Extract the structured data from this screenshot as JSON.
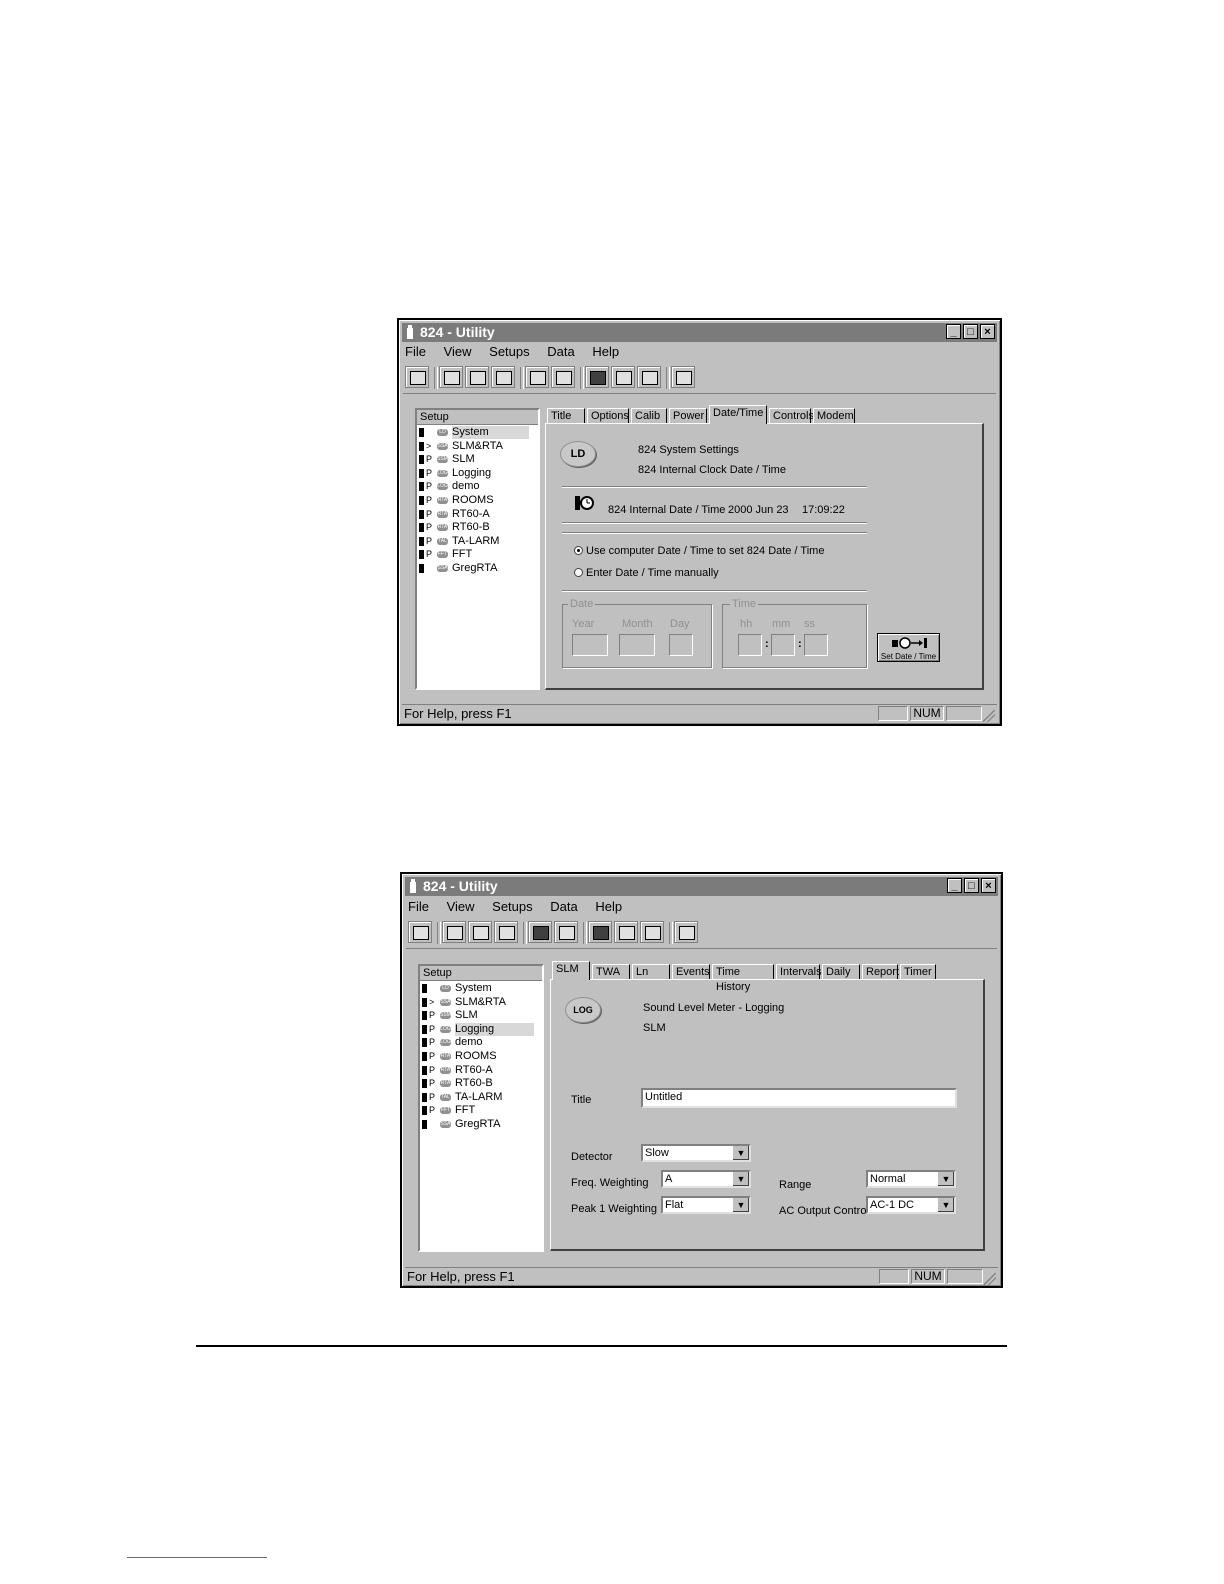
{
  "window1": {
    "title": "824 - Utility",
    "menu": [
      "File",
      "View",
      "Setups",
      "Data",
      "Help"
    ],
    "tree_header": "Setup",
    "tree_items": [
      {
        "badge": "LD",
        "label": "System",
        "mark": ""
      },
      {
        "badge": "SSA",
        "label": "SLM&RTA",
        "mark": ">"
      },
      {
        "badge": "SSM",
        "label": "SLM",
        "mark": "P"
      },
      {
        "badge": "LOG",
        "label": "Logging",
        "mark": "P"
      },
      {
        "badge": "LOG",
        "label": "demo",
        "mark": "P"
      },
      {
        "badge": "RTA",
        "label": "ROOMS",
        "mark": "P"
      },
      {
        "badge": "RTA",
        "label": "RT60-A",
        "mark": "P"
      },
      {
        "badge": "RTA",
        "label": "RT60-B",
        "mark": "P"
      },
      {
        "badge": "TAL",
        "label": "TA-LARM",
        "mark": "P"
      },
      {
        "badge": "FFT",
        "label": "FFT",
        "mark": "P"
      },
      {
        "badge": "SSA",
        "label": "GregRTA",
        "mark": ""
      }
    ],
    "tabs": [
      "Title",
      "Options",
      "Calib",
      "Power",
      "Date/Time",
      "Controls",
      "Modem"
    ],
    "logo": "LD",
    "header_line1": "824 System Settings",
    "header_line2": "824 Internal Clock Date / Time",
    "internal_label": "824 Internal Date / Time",
    "internal_date": "2000 Jun 23",
    "internal_time": "17:09:22",
    "radio_computer": "Use computer Date / Time to set 824 Date / Time",
    "radio_manual": "Enter Date / Time manually",
    "date_group": "Date",
    "year_label": "Year",
    "month_label": "Month",
    "day_label": "Day",
    "time_group": "Time",
    "hh_label": "hh",
    "mm_label": "mm",
    "ss_label": "ss",
    "set_button": "Set Date / Time",
    "status": "For Help, press F1",
    "num": "NUM"
  },
  "window2": {
    "title": "824 - Utility",
    "menu": [
      "File",
      "View",
      "Setups",
      "Data",
      "Help"
    ],
    "tree_header": "Setup",
    "tree_items": [
      {
        "badge": "LD",
        "label": "System",
        "mark": ""
      },
      {
        "badge": "SSA",
        "label": "SLM&RTA",
        "mark": ">"
      },
      {
        "badge": "SSM",
        "label": "SLM",
        "mark": "P"
      },
      {
        "badge": "LOG",
        "label": "Logging",
        "mark": "P"
      },
      {
        "badge": "LOG",
        "label": "demo",
        "mark": "P"
      },
      {
        "badge": "RTA",
        "label": "ROOMS",
        "mark": "P"
      },
      {
        "badge": "RTA",
        "label": "RT60-A",
        "mark": "P"
      },
      {
        "badge": "RTA",
        "label": "RT60-B",
        "mark": "P"
      },
      {
        "badge": "TAL",
        "label": "TA-LARM",
        "mark": "P"
      },
      {
        "badge": "FFT",
        "label": "FFT",
        "mark": "P"
      },
      {
        "badge": "SSA",
        "label": "GregRTA",
        "mark": ""
      }
    ],
    "tabs": [
      "SLM",
      "TWA",
      "Ln",
      "Events",
      "Time History",
      "Intervals",
      "Daily",
      "Report",
      "Timer"
    ],
    "logo": "LOG",
    "header_line1": "Sound Level Meter - Logging",
    "header_line2": "SLM",
    "title_label": "Title",
    "title_value": "Untitled",
    "detector_label": "Detector",
    "detector_value": "Slow",
    "freq_label": "Freq. Weighting",
    "freq_value": "A",
    "peak_label": "Peak 1 Weighting",
    "peak_value": "Flat",
    "range_label": "Range",
    "range_value": "Normal",
    "ac_label": "AC Output Control",
    "ac_value": "AC-1 DC",
    "status": "For Help, press F1",
    "num": "NUM"
  }
}
